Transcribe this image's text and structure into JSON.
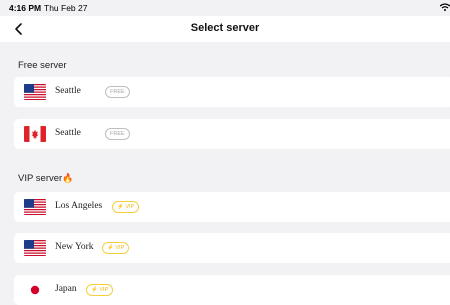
{
  "status": {
    "time": "4:16 PM",
    "date": "Thu Feb 27"
  },
  "nav": {
    "title": "Select server"
  },
  "free_section": {
    "title": "Free server",
    "servers": [
      {
        "country": "us",
        "label": "Seattle",
        "badge": "FREE"
      },
      {
        "country": "ca",
        "label": "Seattle",
        "badge": "FREE"
      }
    ]
  },
  "vip_section": {
    "title": "VIP server",
    "title_icon": "🔥",
    "servers": [
      {
        "country": "us",
        "label": "Los Angeles",
        "badge": "⚡ VIP"
      },
      {
        "country": "us",
        "label": "New York",
        "badge": "⚡ VIP"
      },
      {
        "country": "jp",
        "label": "Japan",
        "badge": "⚡ VIP"
      }
    ]
  },
  "colors": {
    "page_bg": "#f2f2f5",
    "free_badge": "#a5a5a5",
    "vip_badge": "#e9b915"
  }
}
